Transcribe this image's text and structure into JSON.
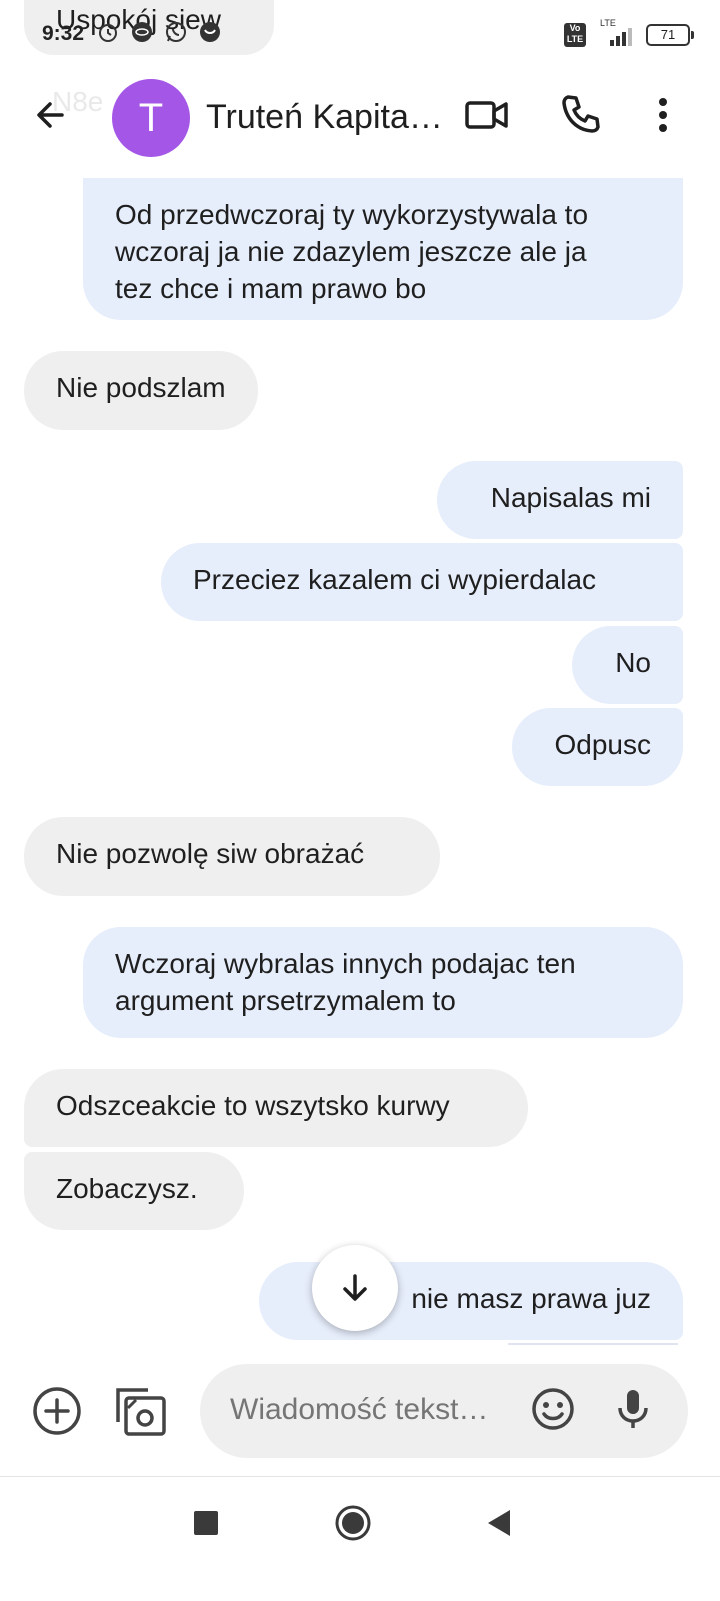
{
  "ghost": {
    "top_bubble_text": "Uspokój siew",
    "faded_text": "N8e"
  },
  "status_bar": {
    "time": "9:32",
    "network": "LTE",
    "volte": "Vo LTE",
    "battery": "71"
  },
  "header": {
    "avatar_letter": "T",
    "contact_name": "Truteń Kapita…",
    "avatar_color": "#a456e6"
  },
  "messages": [
    {
      "direction": "out",
      "text": "Od przedwczoraj ty wykorzystywala to\nwczoraj ja nie zdazylem jeszcze ale ja\ntez chce i mam prawo bo"
    },
    {
      "direction": "in",
      "text": "Nie podszlam"
    },
    {
      "direction": "out",
      "text": "Napisalas mi"
    },
    {
      "direction": "out",
      "text": "Przeciez kazalem ci wypierdalac"
    },
    {
      "direction": "out",
      "text": "No"
    },
    {
      "direction": "out",
      "text": "Odpusc"
    },
    {
      "direction": "in",
      "text": "Nie pozwolę siw obrażać"
    },
    {
      "direction": "out",
      "text": "Wczoraj wybralas innych podajac ten\nargument prsetrzymalem to"
    },
    {
      "direction": "in",
      "text": "Odszceakcie to wszytsko kurwy"
    },
    {
      "direction": "in",
      "text": "Zobaczysz."
    },
    {
      "direction": "out",
      "text": "I t     nie masz prawa juz"
    }
  ],
  "composer": {
    "placeholder": "Wiadomość tekst…"
  },
  "colors": {
    "outgoing_bubble": "#e6edfb",
    "incoming_bubble": "#efefef"
  }
}
